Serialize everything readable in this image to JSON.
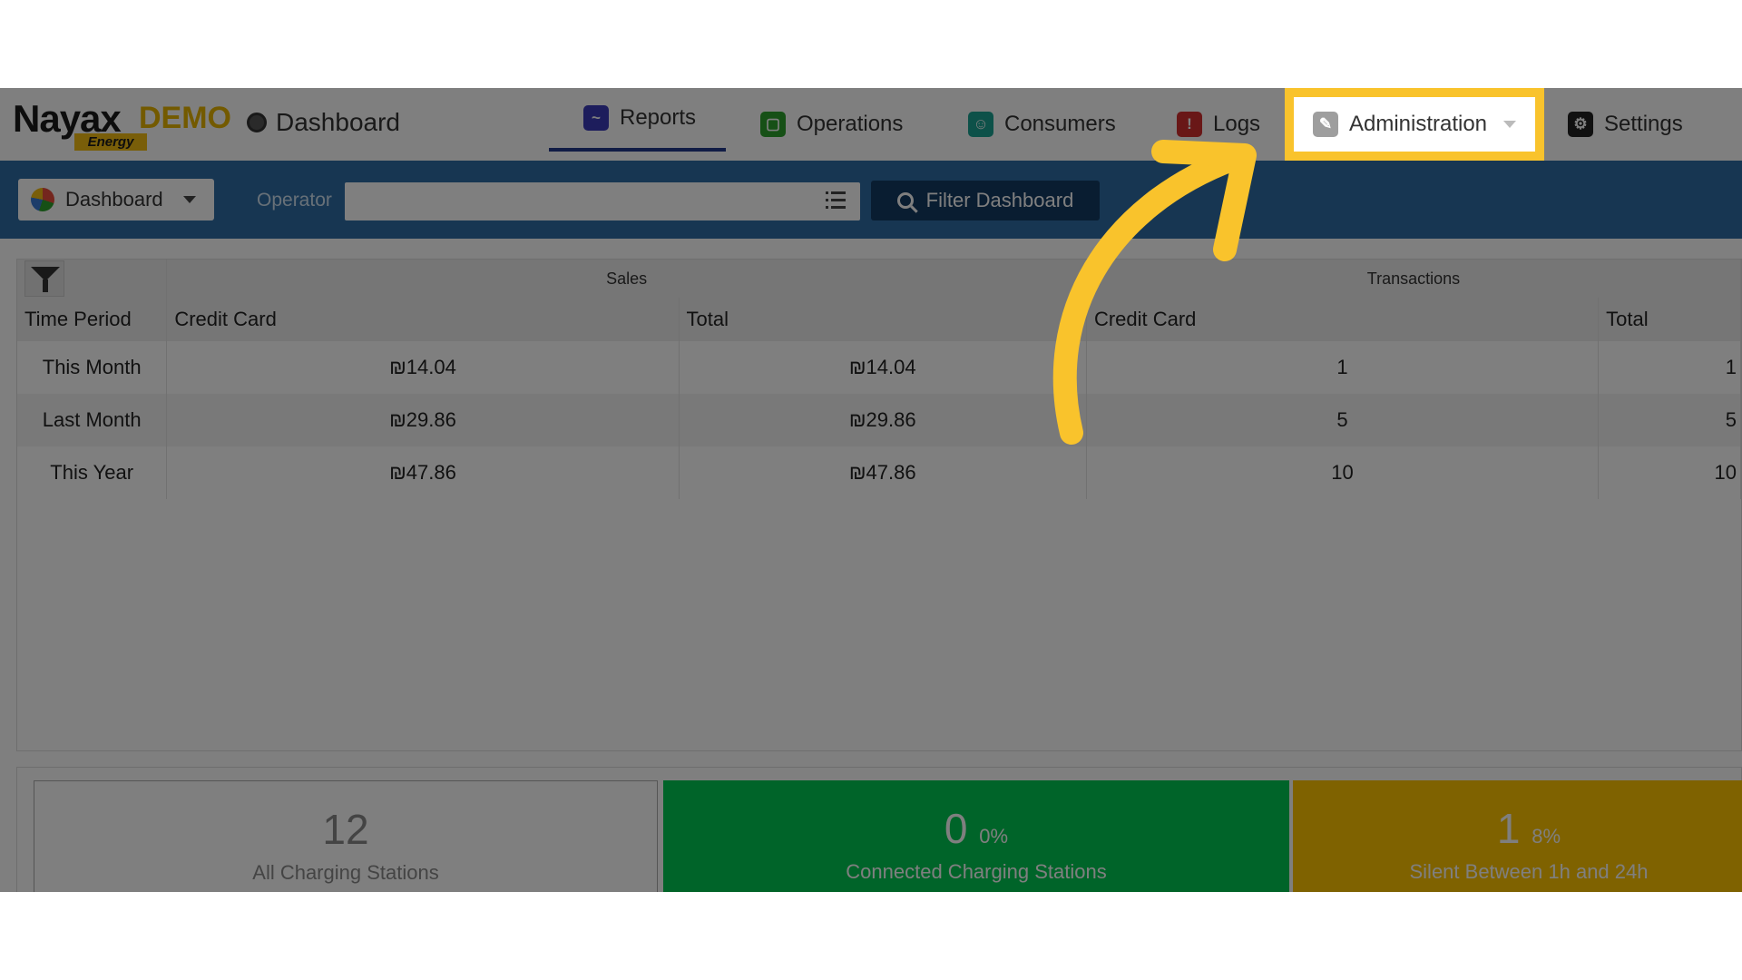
{
  "header": {
    "logo_text": "Nayax",
    "logo_demo": "DEMO",
    "logo_energy": "Energy",
    "breadcrumb": "Dashboard"
  },
  "nav": {
    "reports": "Reports",
    "operations": "Operations",
    "consumers": "Consumers",
    "logs": "Logs",
    "administration": "Administration",
    "settings": "Settings"
  },
  "toolbar": {
    "dashboard_select": "Dashboard",
    "operator_label": "Operator",
    "operator_value": "",
    "filter_button": "Filter Dashboard"
  },
  "table": {
    "groups": {
      "sales": "Sales",
      "transactions": "Transactions"
    },
    "columns": {
      "time_period": "Time Period",
      "credit_card": "Credit Card",
      "total": "Total"
    },
    "rows": [
      {
        "period": "This Month",
        "sales_cc": "₪14.04",
        "sales_total": "₪14.04",
        "tx_cc": "1",
        "tx_total": "1"
      },
      {
        "period": "Last Month",
        "sales_cc": "₪29.86",
        "sales_total": "₪29.86",
        "tx_cc": "5",
        "tx_total": "5"
      },
      {
        "period": "This Year",
        "sales_cc": "₪47.86",
        "sales_total": "₪47.86",
        "tx_cc": "10",
        "tx_total": "10"
      }
    ]
  },
  "stats": [
    {
      "value": "12",
      "pct": "",
      "label": "All Charging Stations"
    },
    {
      "value": "0",
      "pct": "0%",
      "label": "Connected Charging Stations"
    },
    {
      "value": "1",
      "pct": "8%",
      "label": "Silent Between 1h and 24h"
    }
  ],
  "colors": {
    "toolbar": "#2e6da4",
    "highlight": "#f9c32c",
    "connected": "#00c853",
    "silent": "#ffc400"
  }
}
